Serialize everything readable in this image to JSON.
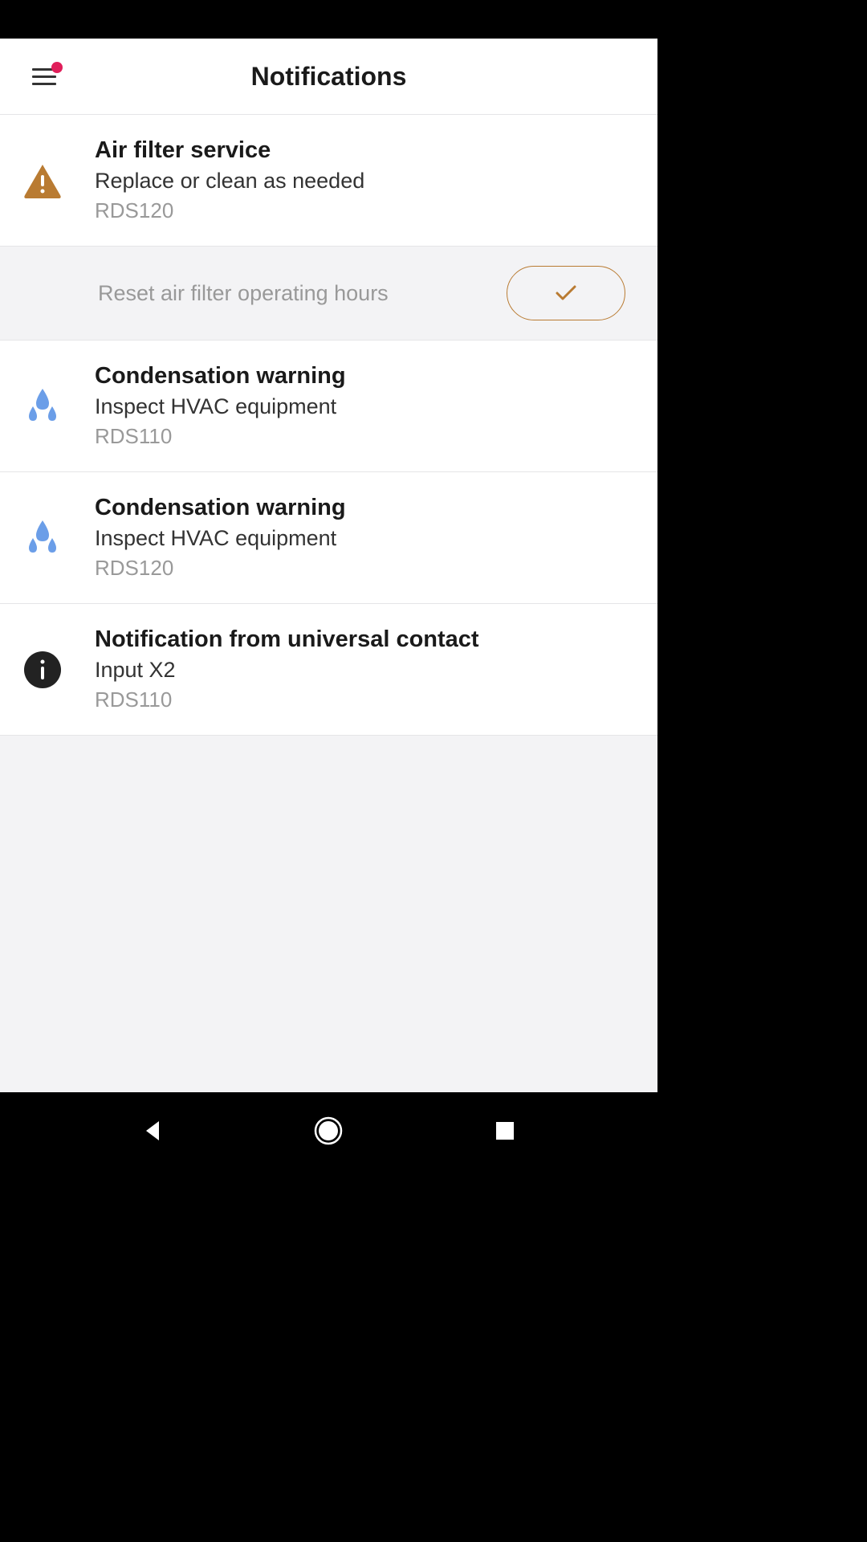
{
  "header": {
    "title": "Notifications"
  },
  "notifications": [
    {
      "icon": "warning-triangle",
      "title": "Air filter service",
      "subtitle": "Replace or clean as needed",
      "device": "RDS120",
      "action": {
        "label": "Reset air filter operating hours"
      }
    },
    {
      "icon": "water-drops",
      "title": "Condensation warning",
      "subtitle": "Inspect HVAC equipment",
      "device": "RDS110"
    },
    {
      "icon": "water-drops",
      "title": "Condensation warning",
      "subtitle": "Inspect HVAC equipment",
      "device": "RDS120"
    },
    {
      "icon": "info-circle",
      "title": "Notification from universal contact",
      "subtitle": "Input X2",
      "device": "RDS110"
    }
  ],
  "colors": {
    "warning": "#b97b32",
    "info_blue": "#6b9ee8",
    "info_dark": "#222"
  }
}
